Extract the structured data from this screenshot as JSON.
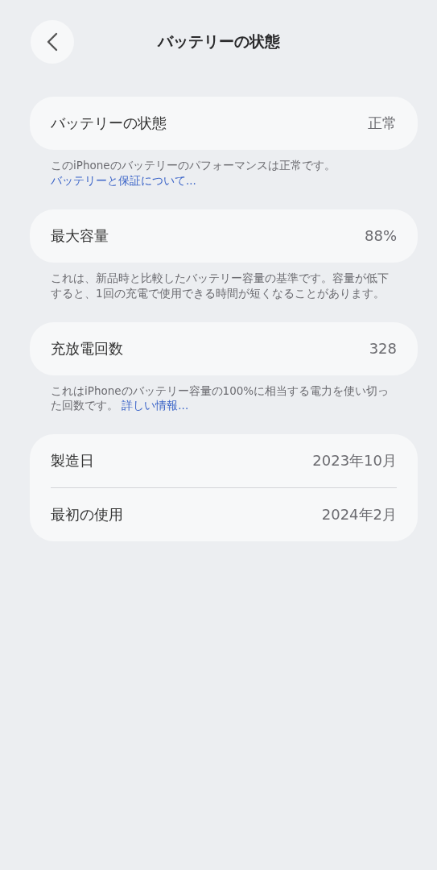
{
  "nav": {
    "title": "バッテリーの状態"
  },
  "sections": [
    {
      "rows": [
        {
          "label": "バッテリーの状態",
          "value": "正常"
        }
      ],
      "note": {
        "text": "このiPhoneのバッテリーのパフォーマンスは正常です。",
        "link": "バッテリーと保証について..."
      }
    },
    {
      "rows": [
        {
          "label": "最大容量",
          "value": "88%"
        }
      ],
      "note": {
        "text": "これは、新品時と比較したバッテリー容量の基準です。容量が低下すると、1回の充電で使用できる時間が短くなることがあります。"
      }
    },
    {
      "rows": [
        {
          "label": "充放電回数",
          "value": "328"
        }
      ],
      "note": {
        "text": "これはiPhoneのバッテリー容量の100%に相当する電力を使い切った回数です。",
        "link": "詳しい情報..."
      }
    },
    {
      "rows": [
        {
          "label": "製造日",
          "value": "2023年10月"
        },
        {
          "label": "最初の使用",
          "value": "2024年2月"
        }
      ]
    }
  ]
}
